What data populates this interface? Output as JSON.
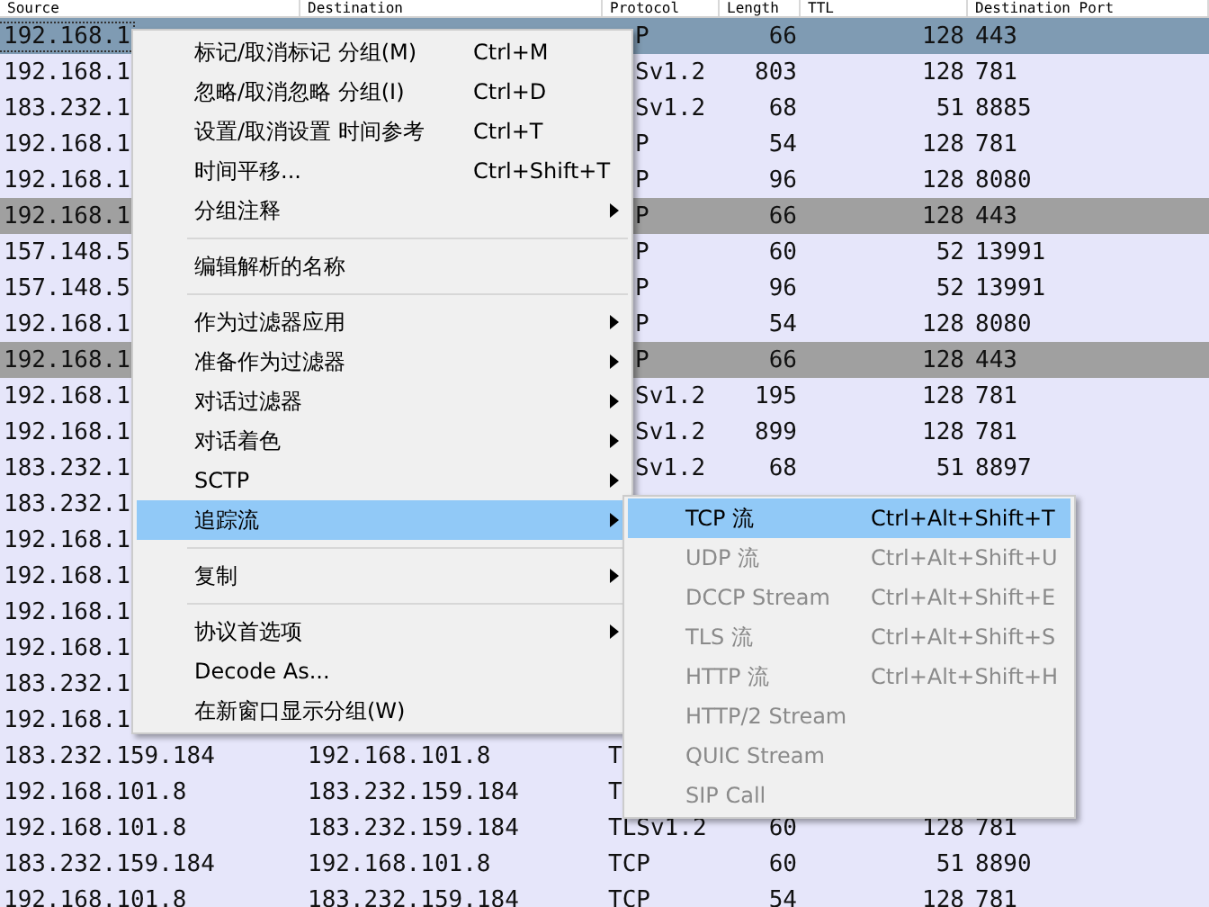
{
  "table": {
    "columns": [
      "Source",
      "Destination",
      "Protocol",
      "Length",
      "TTL",
      "Destination Port"
    ],
    "rows": [
      {
        "kind": "under-menu",
        "selected": true,
        "color": "#7f9bb3",
        "source": "192.168.1",
        "protocol": "P",
        "length": "66",
        "ttl": "128",
        "port": "443"
      },
      {
        "kind": "under-menu",
        "selected": false,
        "color": "#e6e6fa",
        "source": "192.168.1",
        "protocol": "Sv1.2",
        "length": "803",
        "ttl": "128",
        "port": "781"
      },
      {
        "kind": "under-menu",
        "selected": false,
        "color": "#e6e6fa",
        "source": "183.232.1",
        "protocol": "Sv1.2",
        "length": "68",
        "ttl": "51",
        "port": "8885"
      },
      {
        "kind": "under-menu",
        "selected": false,
        "color": "#e6e6fa",
        "source": "192.168.1",
        "protocol": "P",
        "length": "54",
        "ttl": "128",
        "port": "781"
      },
      {
        "kind": "under-menu",
        "selected": false,
        "color": "#e6e6fa",
        "source": "192.168.1",
        "protocol": "P",
        "length": "96",
        "ttl": "128",
        "port": "8080"
      },
      {
        "kind": "under-menu",
        "selected": false,
        "color": "#a0a0a0",
        "source": "192.168.1",
        "protocol": "P",
        "length": "66",
        "ttl": "128",
        "port": "443"
      },
      {
        "kind": "under-menu",
        "selected": false,
        "color": "#e6e6fa",
        "source": "157.148.5",
        "protocol": "P",
        "length": "60",
        "ttl": "52",
        "port": "13991"
      },
      {
        "kind": "under-menu",
        "selected": false,
        "color": "#e6e6fa",
        "source": "157.148.5",
        "protocol": "P",
        "length": "96",
        "ttl": "52",
        "port": "13991"
      },
      {
        "kind": "under-menu",
        "selected": false,
        "color": "#e6e6fa",
        "source": "192.168.1",
        "protocol": "P",
        "length": "54",
        "ttl": "128",
        "port": "8080"
      },
      {
        "kind": "under-menu",
        "selected": false,
        "color": "#a0a0a0",
        "source": "192.168.1",
        "protocol": "P",
        "length": "66",
        "ttl": "128",
        "port": "443"
      },
      {
        "kind": "under-menu",
        "selected": false,
        "color": "#e6e6fa",
        "source": "192.168.1",
        "protocol": "Sv1.2",
        "length": "195",
        "ttl": "128",
        "port": "781"
      },
      {
        "kind": "under-menu",
        "selected": false,
        "color": "#e6e6fa",
        "source": "192.168.1",
        "protocol": "Sv1.2",
        "length": "899",
        "ttl": "128",
        "port": "781"
      },
      {
        "kind": "under-menu",
        "selected": false,
        "color": "#e6e6fa",
        "source": "183.232.1",
        "protocol": "Sv1.2",
        "length": "68",
        "ttl": "51",
        "port": "8897"
      },
      {
        "kind": "under-menu",
        "selected": false,
        "color": "#e6e6fa",
        "source": "183.232.1"
      },
      {
        "kind": "under-menu",
        "selected": false,
        "color": "#e6e6fa",
        "source": "192.168.1"
      },
      {
        "kind": "under-menu",
        "selected": false,
        "color": "#e6e6fa",
        "source": "192.168.1"
      },
      {
        "kind": "under-menu",
        "selected": false,
        "color": "#e6e6fa",
        "source": "192.168.1"
      },
      {
        "kind": "under-menu",
        "selected": false,
        "color": "#e6e6fa",
        "source": "192.168.1"
      },
      {
        "kind": "under-menu",
        "selected": false,
        "color": "#e6e6fa",
        "source": "183.232.1"
      },
      {
        "kind": "under-menu",
        "selected": false,
        "color": "#e6e6fa",
        "source": "192.168.1"
      },
      {
        "kind": "full",
        "selected": false,
        "color": "#e6e6fa",
        "source": "183.232.159.184",
        "destination": "192.168.101.8",
        "protocol": "T"
      },
      {
        "kind": "full",
        "selected": false,
        "color": "#e6e6fa",
        "source": "192.168.101.8",
        "destination": "183.232.159.184",
        "protocol": "T"
      },
      {
        "kind": "full",
        "selected": false,
        "color": "#e6e6fa",
        "source": "192.168.101.8",
        "destination": "183.232.159.184",
        "protocol": "TLSv1.2",
        "length": "60",
        "ttl": "128",
        "port": "781"
      },
      {
        "kind": "full",
        "selected": false,
        "color": "#e6e6fa",
        "source": "183.232.159.184",
        "destination": "192.168.101.8",
        "protocol": "TCP",
        "length": "60",
        "ttl": "51",
        "port": "8890"
      },
      {
        "kind": "full",
        "selected": false,
        "color": "#e6e6fa",
        "source": "192.168.101.8",
        "destination": "183.232.159.184",
        "protocol": "TCP",
        "length": "54",
        "ttl": "128",
        "port": "781"
      }
    ]
  },
  "context_menu": {
    "items": [
      {
        "kind": "item",
        "label": "标记/取消标记 分组(M)",
        "shortcut": "Ctrl+M",
        "submenu": false,
        "selected": false
      },
      {
        "kind": "item",
        "label": "忽略/取消忽略 分组(I)",
        "shortcut": "Ctrl+D",
        "submenu": false,
        "selected": false
      },
      {
        "kind": "item",
        "label": "设置/取消设置 时间参考",
        "shortcut": "Ctrl+T",
        "submenu": false,
        "selected": false
      },
      {
        "kind": "item",
        "label": "时间平移...",
        "shortcut": "Ctrl+Shift+T",
        "submenu": false,
        "selected": false
      },
      {
        "kind": "item",
        "label": "分组注释",
        "submenu": true,
        "selected": false
      },
      {
        "kind": "separator"
      },
      {
        "kind": "item",
        "label": "编辑解析的名称",
        "submenu": false,
        "selected": false
      },
      {
        "kind": "separator"
      },
      {
        "kind": "item",
        "label": "作为过滤器应用",
        "submenu": true,
        "selected": false
      },
      {
        "kind": "item",
        "label": "准备作为过滤器",
        "submenu": true,
        "selected": false
      },
      {
        "kind": "item",
        "label": "对话过滤器",
        "submenu": true,
        "selected": false
      },
      {
        "kind": "item",
        "label": "对话着色",
        "submenu": true,
        "selected": false
      },
      {
        "kind": "item",
        "label": "SCTP",
        "submenu": true,
        "selected": false
      },
      {
        "kind": "item",
        "label": "追踪流",
        "submenu": true,
        "selected": true
      },
      {
        "kind": "separator"
      },
      {
        "kind": "item",
        "label": "复制",
        "submenu": true,
        "selected": false
      },
      {
        "kind": "separator"
      },
      {
        "kind": "item",
        "label": "协议首选项",
        "submenu": true,
        "selected": false
      },
      {
        "kind": "item",
        "label": "Decode As...",
        "submenu": false,
        "selected": false
      },
      {
        "kind": "item",
        "label": "在新窗口显示分组(W)",
        "submenu": false,
        "selected": false
      }
    ]
  },
  "submenu": {
    "items": [
      {
        "label": "TCP 流",
        "shortcut": "Ctrl+Alt+Shift+T",
        "disabled": false,
        "selected": true
      },
      {
        "label": "UDP 流",
        "shortcut": "Ctrl+Alt+Shift+U",
        "disabled": true,
        "selected": false
      },
      {
        "label": "DCCP Stream",
        "shortcut": "Ctrl+Alt+Shift+E",
        "disabled": true,
        "selected": false
      },
      {
        "label": "TLS 流",
        "shortcut": "Ctrl+Alt+Shift+S",
        "disabled": true,
        "selected": false
      },
      {
        "label": "HTTP 流",
        "shortcut": "Ctrl+Alt+Shift+H",
        "disabled": true,
        "selected": false
      },
      {
        "label": "HTTP/2 Stream",
        "disabled": true,
        "selected": false
      },
      {
        "label": "QUIC Stream",
        "disabled": true,
        "selected": false
      },
      {
        "label": "SIP Call",
        "disabled": true,
        "selected": false
      }
    ]
  }
}
